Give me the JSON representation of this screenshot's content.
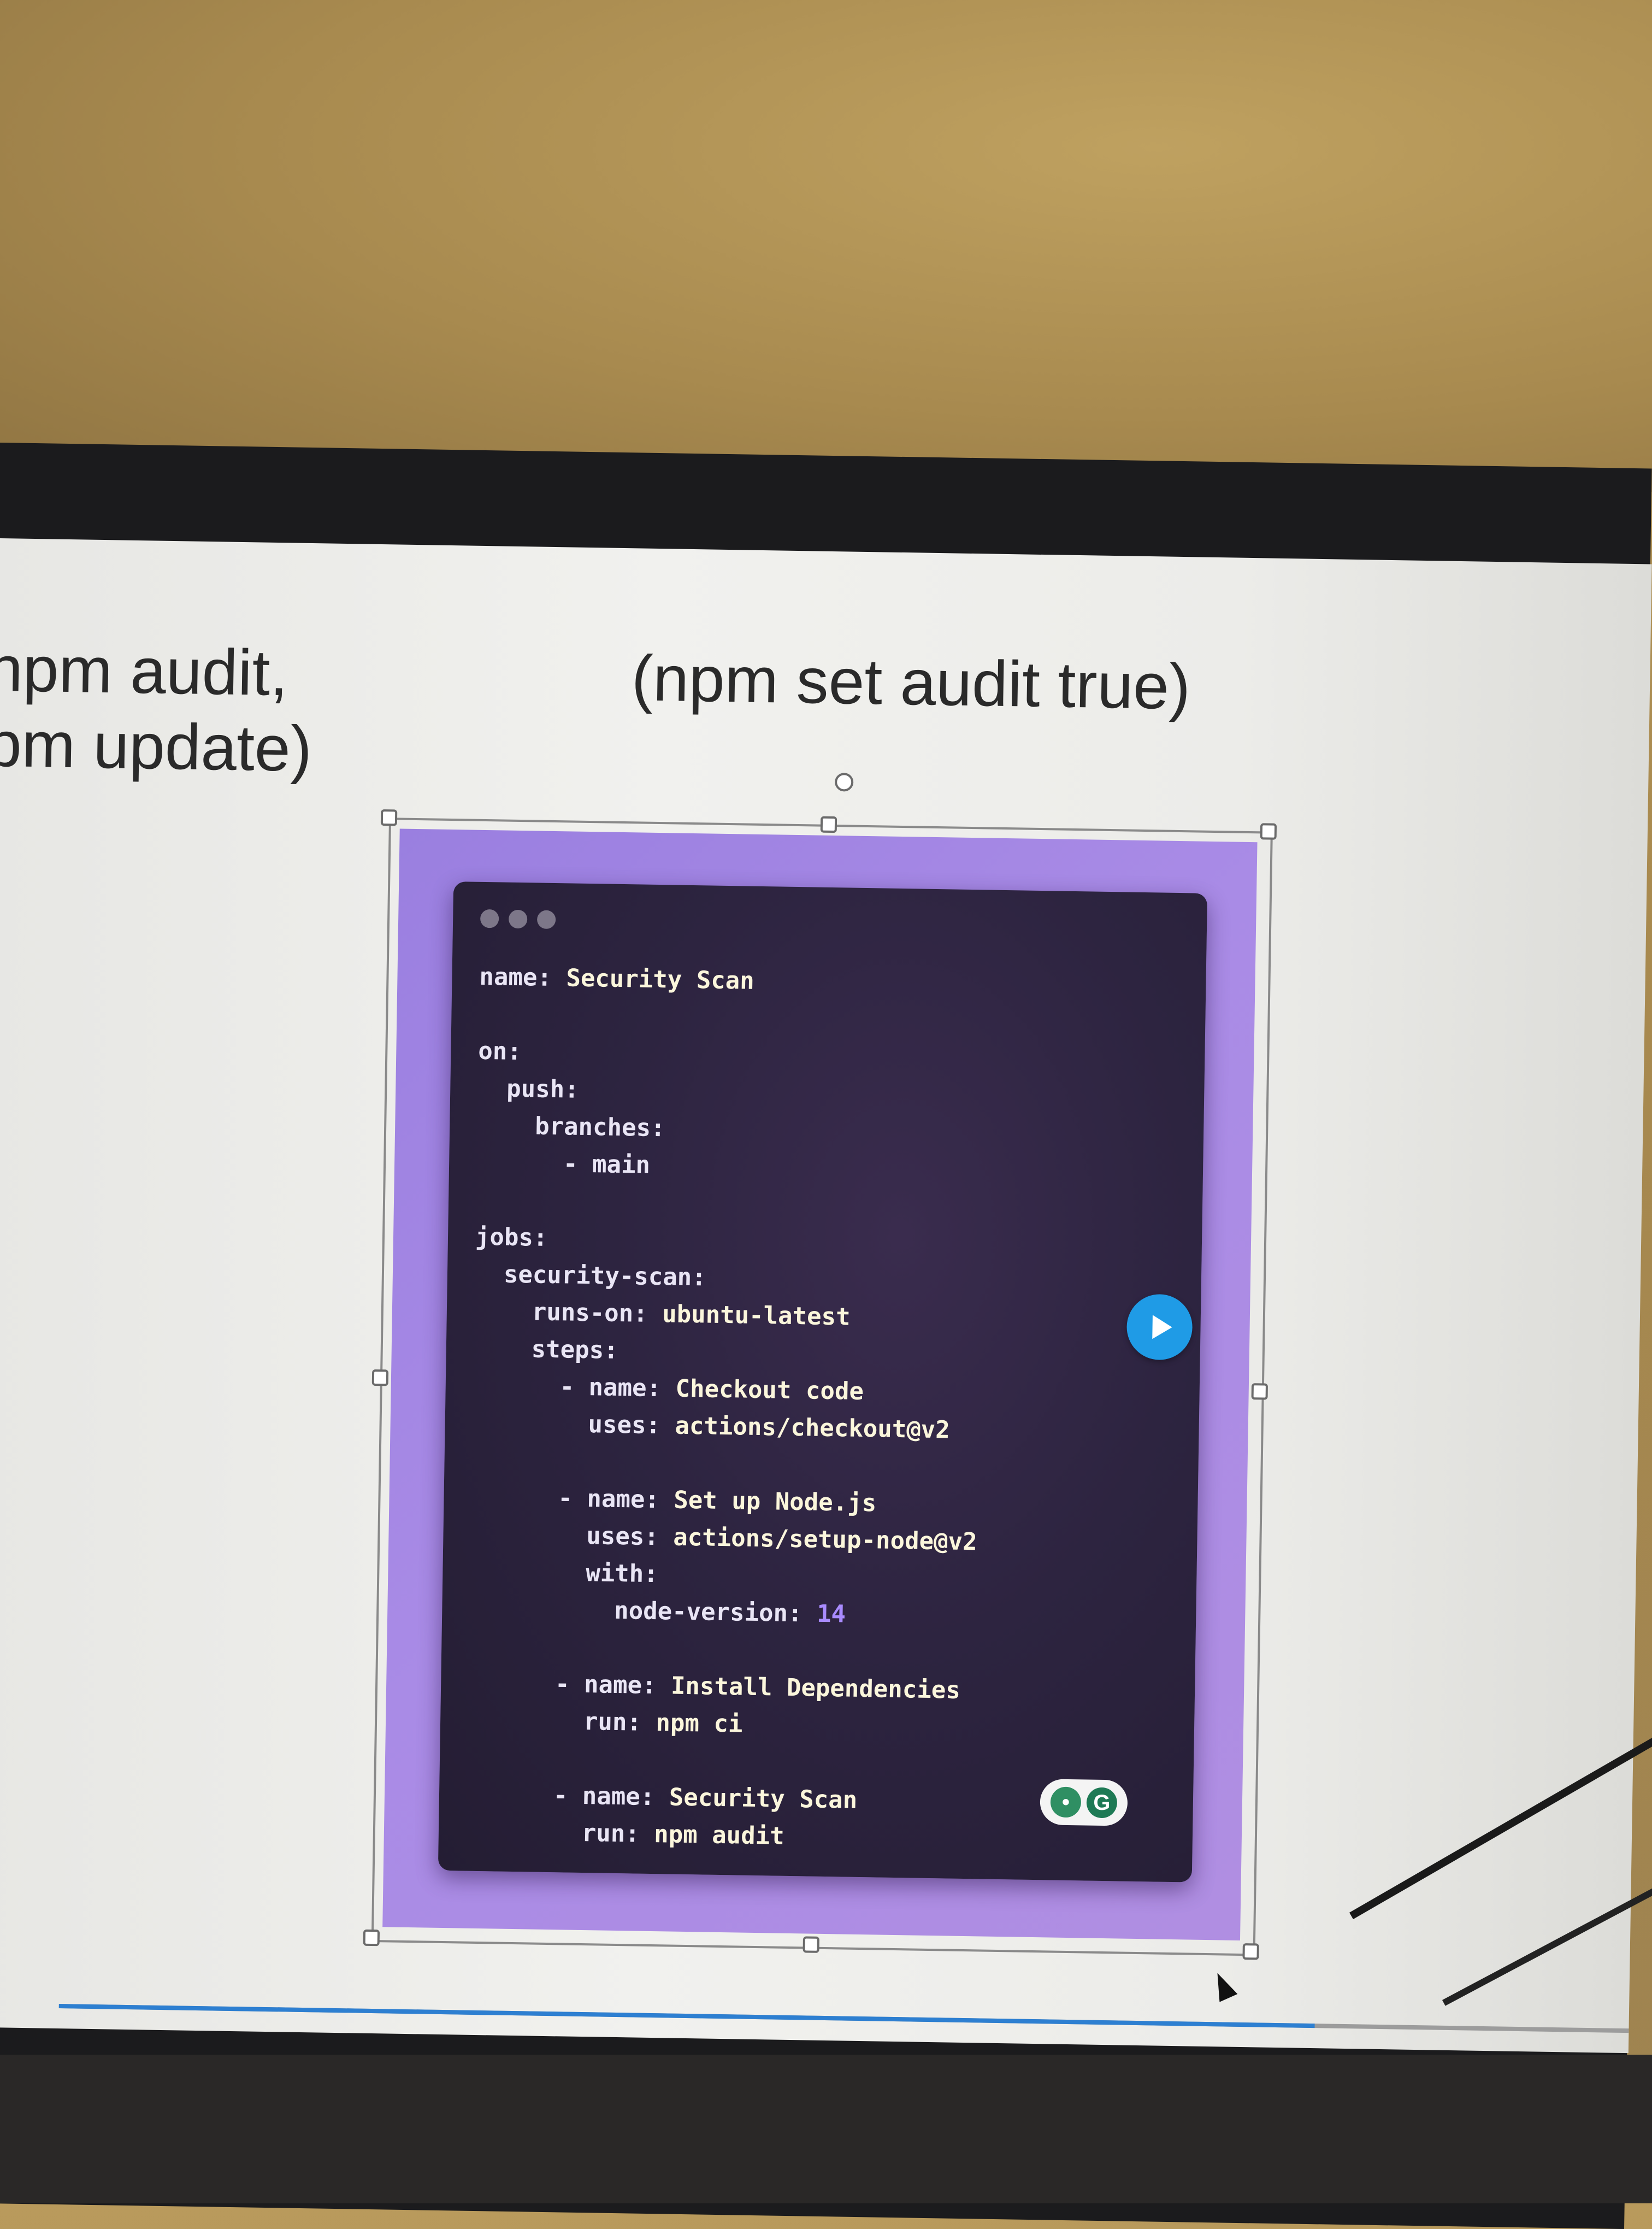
{
  "slide": {
    "left_text": "npm audit,\npm update)",
    "right_text": "(npm set audit true)"
  },
  "code_window": {
    "lines": [
      {
        "indent": "",
        "key": "name:",
        "value": " Security Scan"
      },
      {
        "indent": "",
        "key": "",
        "value": ""
      },
      {
        "indent": "",
        "key": "on:",
        "value": ""
      },
      {
        "indent": "  ",
        "key": "push:",
        "value": ""
      },
      {
        "indent": "    ",
        "key": "branches:",
        "value": ""
      },
      {
        "indent": "      ",
        "key": "- main",
        "value": ""
      },
      {
        "indent": "",
        "key": "",
        "value": ""
      },
      {
        "indent": "",
        "key": "jobs:",
        "value": ""
      },
      {
        "indent": "  ",
        "key": "security-scan:",
        "value": ""
      },
      {
        "indent": "    ",
        "key": "runs-on:",
        "value": " ubuntu-latest"
      },
      {
        "indent": "    ",
        "key": "steps:",
        "value": ""
      },
      {
        "indent": "      ",
        "key": "- name:",
        "value": " Checkout code"
      },
      {
        "indent": "        ",
        "key": "uses:",
        "value": " actions/checkout@v2"
      },
      {
        "indent": "",
        "key": "",
        "value": ""
      },
      {
        "indent": "      ",
        "key": "- name:",
        "value": " Set up Node.js"
      },
      {
        "indent": "        ",
        "key": "uses:",
        "value": " actions/setup-node@v2"
      },
      {
        "indent": "        ",
        "key": "with:",
        "value": ""
      },
      {
        "indent": "          ",
        "key": "node-version:",
        "value": " ",
        "num": "14"
      },
      {
        "indent": "",
        "key": "",
        "value": ""
      },
      {
        "indent": "      ",
        "key": "- name:",
        "value": " Install Dependencies"
      },
      {
        "indent": "        ",
        "key": "run:",
        "value": " npm ci"
      },
      {
        "indent": "",
        "key": "",
        "value": ""
      },
      {
        "indent": "      ",
        "key": "- name:",
        "value": " Security Scan"
      },
      {
        "indent": "        ",
        "key": "run:",
        "value": " npm audit"
      }
    ]
  },
  "icons": {
    "play": "play-icon",
    "extension": "grammarly-icon",
    "extension_letter": "G"
  },
  "video_progress": 0.8,
  "colors": {
    "purple_bg": "#a98be6",
    "code_bg": "#2d2440",
    "play_blue": "#1f9be6",
    "progress_blue": "#2d7fd1"
  }
}
